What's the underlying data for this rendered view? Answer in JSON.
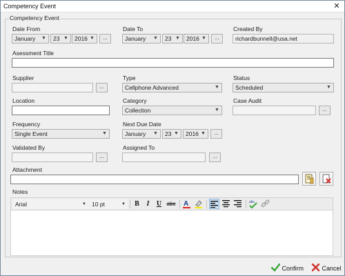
{
  "window": {
    "title": "Competency Event",
    "close_glyph": "✕"
  },
  "group_title": "Competency Event",
  "date_from": {
    "label": "Date From",
    "month": "January",
    "day": "23",
    "year": "2016",
    "picker_label": "..."
  },
  "date_to": {
    "label": "Date To",
    "month": "January",
    "day": "23",
    "year": "2016",
    "picker_label": "..."
  },
  "created_by": {
    "label": "Created By",
    "value": "richardbunnell@usa.net"
  },
  "assessment_title": {
    "label": "Asessment Title",
    "value": ""
  },
  "supplier": {
    "label": "Supplier",
    "value": "",
    "picker_label": "..."
  },
  "type": {
    "label": "Type",
    "value": "Cellphone Advanced"
  },
  "status": {
    "label": "Status",
    "value": "Scheduled"
  },
  "location": {
    "label": "Location",
    "value": ""
  },
  "category": {
    "label": "Category",
    "value": "Collection"
  },
  "case_audit": {
    "label": "Case Audit",
    "value": "",
    "picker_label": "..."
  },
  "frequency": {
    "label": "Frequency",
    "value": "Single Event"
  },
  "next_due_date": {
    "label": "Next Due Date",
    "month": "January",
    "day": "23",
    "year": "2016",
    "picker_label": "..."
  },
  "validated_by": {
    "label": "Validated By",
    "value": "",
    "picker_label": "..."
  },
  "assigned_to": {
    "label": "Assigned To",
    "value": "",
    "picker_label": "..."
  },
  "attachment": {
    "label": "Attachment",
    "value": ""
  },
  "notes": {
    "label": "Notes",
    "font": "Arial",
    "size": "10 pt",
    "bold": "B",
    "italic": "I",
    "underline": "U",
    "strike": "abc",
    "font_color": "A"
  },
  "footer": {
    "confirm_label": "Confirm",
    "cancel_label": "Cancel"
  },
  "colors": {
    "confirm_check": "#3aa53a",
    "cancel_x": "#d0312d",
    "font_color_bar": "#e0201b",
    "highlight_bar": "#f5e800"
  }
}
